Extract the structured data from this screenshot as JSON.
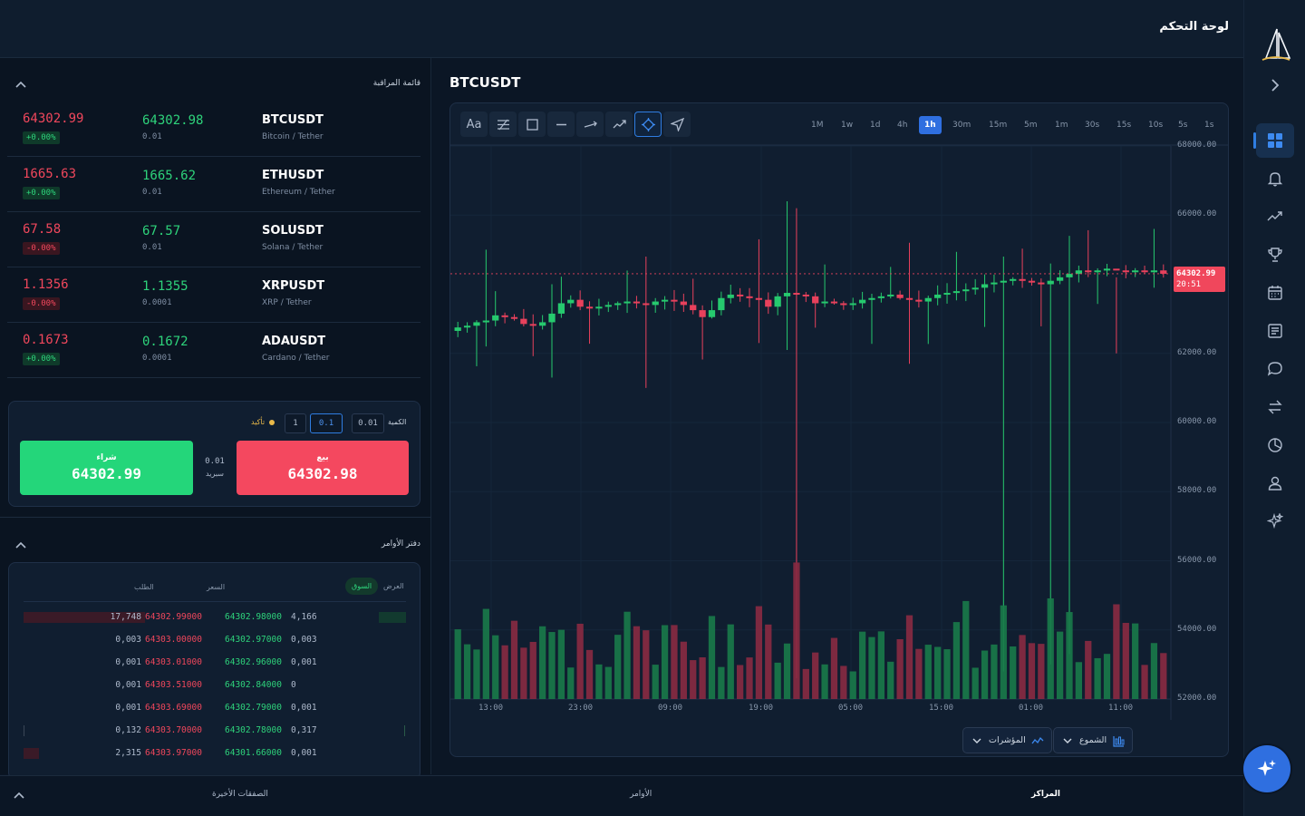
{
  "header": {
    "title": "لوحة التحكم"
  },
  "sidebar": {
    "logo": "sailboat-logo",
    "items": [
      {
        "icon": "dashboard-icon",
        "active": true
      },
      {
        "icon": "bell-icon"
      },
      {
        "icon": "trending-icon"
      },
      {
        "icon": "trophy-icon"
      },
      {
        "icon": "calendar-icon"
      },
      {
        "icon": "news-icon"
      },
      {
        "icon": "chat-icon"
      },
      {
        "icon": "transfer-icon"
      },
      {
        "icon": "pie-chart-icon"
      },
      {
        "icon": "user-icon"
      },
      {
        "icon": "sparkles-icon"
      }
    ]
  },
  "watchlist": {
    "title": "قائمة المراقبة",
    "items": [
      {
        "sell": "64302.99",
        "change": "+0.00%",
        "buy": "64302.98",
        "step": "0.01",
        "symbol": "BTCUSDT",
        "name": "Bitcoin / Tether",
        "trend": "pos"
      },
      {
        "sell": "1665.63",
        "change": "+0.00%",
        "buy": "1665.62",
        "step": "0.01",
        "symbol": "ETHUSDT",
        "name": "Ethereum / Tether",
        "trend": "pos"
      },
      {
        "sell": "67.58",
        "change": "-0.00%",
        "buy": "67.57",
        "step": "0.01",
        "symbol": "SOLUSDT",
        "name": "Solana / Tether",
        "trend": "neg"
      },
      {
        "sell": "1.1356",
        "change": "-0.00%",
        "buy": "1.1355",
        "step": "0.0001",
        "symbol": "XRPUSDT",
        "name": "XRP / Tether",
        "trend": "neg"
      },
      {
        "sell": "0.1673",
        "change": "+0.00%",
        "buy": "0.1672",
        "step": "0.0001",
        "symbol": "ADAUSDT",
        "name": "Cardano / Tether",
        "trend": "pos"
      }
    ]
  },
  "trade": {
    "quantity_label": "الكمية",
    "quantities": [
      "0.01",
      "0.1",
      "1"
    ],
    "selected_quantity": "0.1",
    "confirm_label": "تأكيد",
    "buy_label": "شراء",
    "buy_price": "64302.99",
    "sell_label": "بيع",
    "sell_price": "64302.98",
    "spread_value": "0.01",
    "spread_label": "سبريد",
    "colors": {
      "buy": "#24d67a",
      "sell": "#f4485f"
    }
  },
  "orderbook": {
    "title": "دفتر الأوامر",
    "headers": {
      "bid": "الطلب",
      "price": "السعر",
      "market": "السوق",
      "offer": "العرض"
    },
    "rows": [
      {
        "bid_qty": "17,748",
        "bid_price": "64302.99000",
        "ask_price": "64302.98000",
        "ask_qty": "4,166",
        "bid_depth": 1.0,
        "ask_depth": 1.0
      },
      {
        "bid_qty": "0,003",
        "bid_price": "64303.00000",
        "ask_price": "64302.97000",
        "ask_qty": "0,003",
        "bid_depth": 0,
        "ask_depth": 0
      },
      {
        "bid_qty": "0,001",
        "bid_price": "64303.01000",
        "ask_price": "64302.96000",
        "ask_qty": "0,001",
        "bid_depth": 0,
        "ask_depth": 0
      },
      {
        "bid_qty": "0,001",
        "bid_price": "64303.51000",
        "ask_price": "64302.84000",
        "ask_qty": "0",
        "bid_depth": 0,
        "ask_depth": 0
      },
      {
        "bid_qty": "0,001",
        "bid_price": "64303.69000",
        "ask_price": "64302.79000",
        "ask_qty": "0,001",
        "bid_depth": 0,
        "ask_depth": 0
      },
      {
        "bid_qty": "0,132",
        "bid_price": "64303.70000",
        "ask_price": "64302.78000",
        "ask_qty": "0,317",
        "bid_depth": 0.01,
        "ask_depth": 0.07
      },
      {
        "bid_qty": "2,315",
        "bid_price": "64303.97000",
        "ask_price": "64301.66000",
        "ask_qty": "0,001",
        "bid_depth": 0.13,
        "ask_depth": 0
      }
    ]
  },
  "chart": {
    "symbol": "BTCUSDT",
    "tools": [
      "text-tool-icon",
      "fib-tool-icon",
      "rectangle-tool-icon",
      "hline-tool-icon",
      "ray-tool-icon",
      "trend-tool-icon",
      "crosshair-tool-icon",
      "cursor-tool-icon"
    ],
    "tools_text_label": "Aa",
    "timeframes": [
      "1M",
      "1w",
      "1d",
      "4h",
      "1h",
      "30m",
      "15m",
      "5m",
      "1m",
      "30s",
      "15s",
      "10s",
      "5s",
      "1s"
    ],
    "active_timeframe": "1h",
    "y_labels": [
      "68000.00",
      "66000.00",
      "62000.00",
      "60000.00",
      "58000.00",
      "56000.00",
      "54000.00",
      "52000.00"
    ],
    "x_labels": [
      "13:00",
      "23:00",
      "09:00",
      "19:00",
      "05:00",
      "15:00",
      "01:00",
      "11:00"
    ],
    "last_price": "64302.99",
    "countdown": "20:51",
    "candles_button": "الشموع",
    "indicators_button": "المؤشرات"
  },
  "chart_data": {
    "type": "candlestick",
    "ylim": [
      52000,
      68000
    ],
    "y_ticks": [
      68000,
      66000,
      62000,
      60000,
      58000,
      56000,
      54000,
      52000
    ],
    "x_tick_labels": [
      "13:00",
      "23:00",
      "09:00",
      "19:00",
      "05:00",
      "15:00",
      "01:00",
      "11:00"
    ],
    "last_price": 64302.99,
    "candles_close": [
      62750,
      62800,
      62900,
      62950,
      63100,
      63050,
      63000,
      62850,
      62800,
      62900,
      63150,
      63450,
      63550,
      63350,
      63300,
      63350,
      63400,
      63450,
      63500,
      63450,
      63400,
      63500,
      63550,
      63500,
      63400,
      63250,
      63050,
      63250,
      63600,
      63700,
      63650,
      63600,
      63550,
      63350,
      63650,
      63750,
      63700,
      63650,
      63450,
      63500,
      63450,
      63400,
      63450,
      63550,
      63600,
      63650,
      63700,
      63600,
      63550,
      63500,
      63600,
      63700,
      63750,
      63800,
      63850,
      63900,
      64000,
      64050,
      64100,
      64150,
      64100,
      64050,
      64000,
      64100,
      64200,
      64300,
      64400,
      64350,
      64400,
      64450,
      64400,
      64350,
      64400,
      64350,
      64400,
      64303
    ],
    "volume_note": "volume bars along bottom, relative scale"
  },
  "bottom_tabs": [
    {
      "label": "المراكز",
      "active": true
    },
    {
      "label": "الأوامر",
      "active": false
    },
    {
      "label": "الصفقات الأخيرة",
      "active": false
    }
  ]
}
